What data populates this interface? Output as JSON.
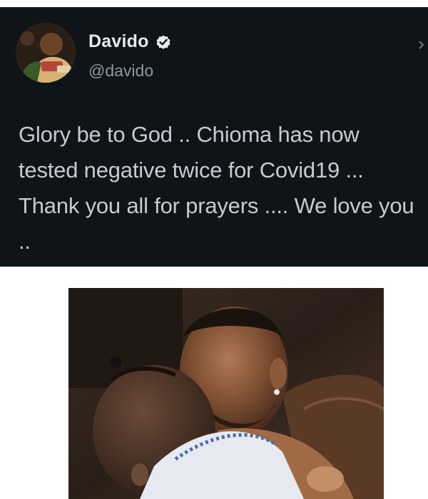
{
  "tweet": {
    "display_name": "Davido",
    "handle": "@davido",
    "verified": true,
    "text": "Glory be to God .. Chioma has now tested negative twice for Covid19 ... Thank you all for prayers .... We love you ..",
    "icons": {
      "verified": "verified-badge-icon",
      "more": "more-options-icon"
    },
    "colors": {
      "background": "#0f1419",
      "name": "#e7e9ea",
      "handle": "#8b98a5",
      "text": "#c5cbd0"
    }
  },
  "photo": {
    "subject": "man kissing baby"
  }
}
